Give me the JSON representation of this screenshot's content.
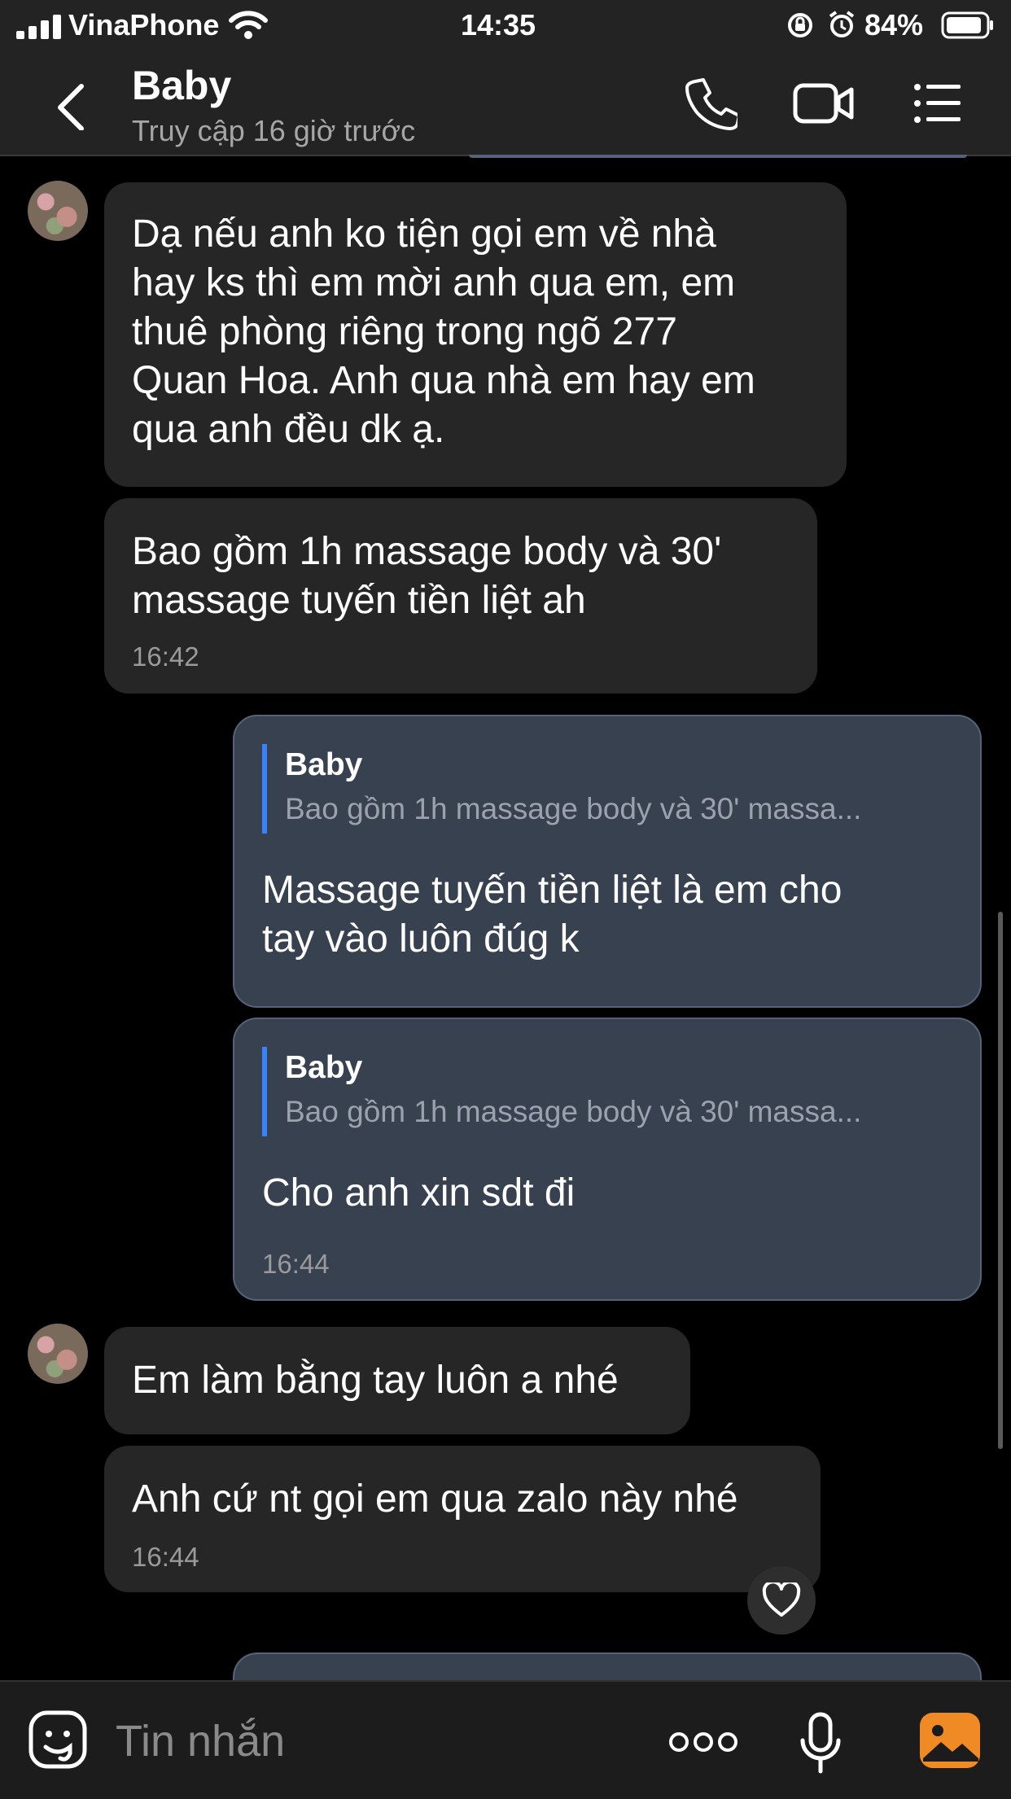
{
  "status_bar": {
    "carrier": "VinaPhone",
    "time": "14:35",
    "battery": "84%"
  },
  "header": {
    "title": "Baby",
    "subtitle": "Truy cập 16 giờ trước"
  },
  "messages": [
    {
      "text": "Dạ nếu anh ko tiện gọi em về nhà\nhay ks thì em mời anh qua em, em\nthuê phòng riêng trong ngõ 277\nQuan Hoa. Anh qua nhà em hay em\nqua anh đều dk ạ."
    },
    {
      "text": "Bao gồm 1h massage body và 30'\nmassage tuyến tiền liệt ah",
      "time": "16:42"
    },
    {
      "quote_name": "Baby",
      "quote_text": "Bao gồm 1h massage body và 30' massa...",
      "text": "Massage tuyến tiền liệt là em cho\ntay vào luôn đúg k"
    },
    {
      "quote_name": "Baby",
      "quote_text": "Bao gồm 1h massage body và 30' massa...",
      "text": "Cho anh xin sdt đi",
      "time": "16:44"
    },
    {
      "text": "Em làm bằng tay luôn a nhé"
    },
    {
      "text": "Anh cứ nt gọi em qua zalo này nhé",
      "time": "16:44"
    }
  ],
  "composer": {
    "placeholder": "Tin nhắn"
  },
  "icons": {
    "back": "chevron-left-icon",
    "call": "phone-icon",
    "video": "video-camera-icon",
    "menu": "list-icon",
    "sticker": "sticker-icon",
    "more": "more-dots-icon",
    "mic": "microphone-icon",
    "image": "image-icon",
    "like": "heart-icon"
  },
  "colors": {
    "incoming_bubble": "#262626",
    "outgoing_bubble": "#384150",
    "accent": "#3a82f7",
    "image_icon": "#f08a24"
  }
}
